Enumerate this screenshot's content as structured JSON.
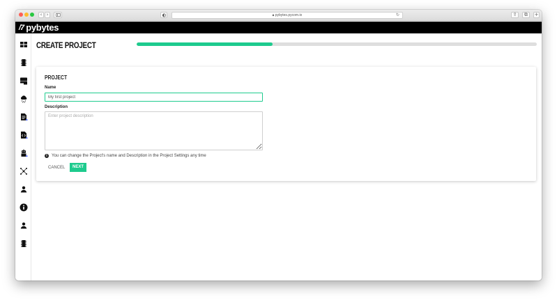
{
  "browser": {
    "url": "pybytes.pycom.io",
    "back_glyph": "‹",
    "forward_glyph": "›",
    "reload_glyph": "↻",
    "share_glyph": "⇪",
    "tabs_glyph": "⧉",
    "new_tab_glyph": "+"
  },
  "app": {
    "logo_mark": "/7",
    "logo_text": "pybytes"
  },
  "sidebar": {
    "items": [
      {
        "name": "dashboard-icon"
      },
      {
        "name": "devices-icon"
      },
      {
        "name": "server-icon"
      },
      {
        "name": "cloud-icon"
      },
      {
        "name": "document-icon"
      },
      {
        "name": "code-file-icon"
      },
      {
        "name": "robot-icon"
      },
      {
        "name": "network-icon"
      },
      {
        "name": "user-icon"
      },
      {
        "name": "info-icon"
      },
      {
        "name": "account-icon"
      },
      {
        "name": "chip-icon"
      }
    ]
  },
  "page": {
    "title": "CREATE PROJECT",
    "progress": 0.34,
    "accent_color": "#1ecb8e"
  },
  "form": {
    "section_heading": "PROJECT",
    "name_label": "Name",
    "name_value": "My first project",
    "description_label": "Description",
    "description_placeholder": "Enter project description",
    "hint": "You can change the Project's name and Description in the Project Settings any time",
    "cancel_label": "CANCEL",
    "next_label": "NEXT"
  }
}
